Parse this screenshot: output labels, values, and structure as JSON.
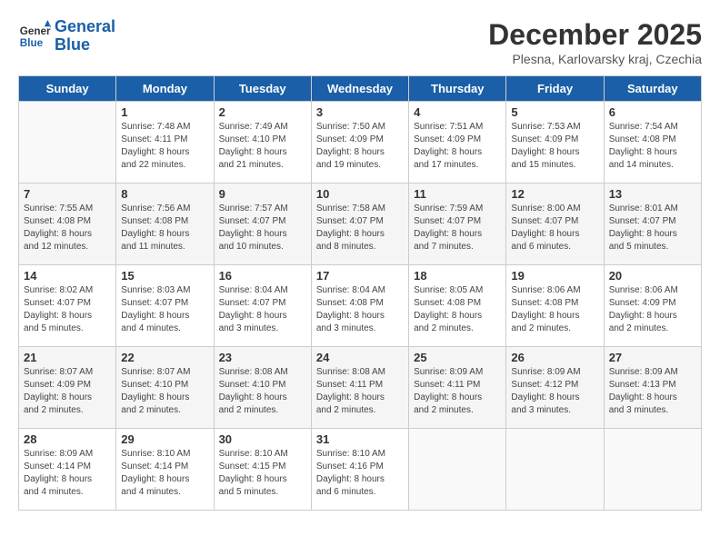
{
  "logo": {
    "line1": "General",
    "line2": "Blue"
  },
  "title": "December 2025",
  "subtitle": "Plesna, Karlovarsky kraj, Czechia",
  "weekdays": [
    "Sunday",
    "Monday",
    "Tuesday",
    "Wednesday",
    "Thursday",
    "Friday",
    "Saturday"
  ],
  "weeks": [
    [
      {
        "day": "",
        "info": ""
      },
      {
        "day": "1",
        "info": "Sunrise: 7:48 AM\nSunset: 4:11 PM\nDaylight: 8 hours\nand 22 minutes."
      },
      {
        "day": "2",
        "info": "Sunrise: 7:49 AM\nSunset: 4:10 PM\nDaylight: 8 hours\nand 21 minutes."
      },
      {
        "day": "3",
        "info": "Sunrise: 7:50 AM\nSunset: 4:09 PM\nDaylight: 8 hours\nand 19 minutes."
      },
      {
        "day": "4",
        "info": "Sunrise: 7:51 AM\nSunset: 4:09 PM\nDaylight: 8 hours\nand 17 minutes."
      },
      {
        "day": "5",
        "info": "Sunrise: 7:53 AM\nSunset: 4:09 PM\nDaylight: 8 hours\nand 15 minutes."
      },
      {
        "day": "6",
        "info": "Sunrise: 7:54 AM\nSunset: 4:08 PM\nDaylight: 8 hours\nand 14 minutes."
      }
    ],
    [
      {
        "day": "7",
        "info": "Sunrise: 7:55 AM\nSunset: 4:08 PM\nDaylight: 8 hours\nand 12 minutes."
      },
      {
        "day": "8",
        "info": "Sunrise: 7:56 AM\nSunset: 4:08 PM\nDaylight: 8 hours\nand 11 minutes."
      },
      {
        "day": "9",
        "info": "Sunrise: 7:57 AM\nSunset: 4:07 PM\nDaylight: 8 hours\nand 10 minutes."
      },
      {
        "day": "10",
        "info": "Sunrise: 7:58 AM\nSunset: 4:07 PM\nDaylight: 8 hours\nand 8 minutes."
      },
      {
        "day": "11",
        "info": "Sunrise: 7:59 AM\nSunset: 4:07 PM\nDaylight: 8 hours\nand 7 minutes."
      },
      {
        "day": "12",
        "info": "Sunrise: 8:00 AM\nSunset: 4:07 PM\nDaylight: 8 hours\nand 6 minutes."
      },
      {
        "day": "13",
        "info": "Sunrise: 8:01 AM\nSunset: 4:07 PM\nDaylight: 8 hours\nand 5 minutes."
      }
    ],
    [
      {
        "day": "14",
        "info": "Sunrise: 8:02 AM\nSunset: 4:07 PM\nDaylight: 8 hours\nand 5 minutes."
      },
      {
        "day": "15",
        "info": "Sunrise: 8:03 AM\nSunset: 4:07 PM\nDaylight: 8 hours\nand 4 minutes."
      },
      {
        "day": "16",
        "info": "Sunrise: 8:04 AM\nSunset: 4:07 PM\nDaylight: 8 hours\nand 3 minutes."
      },
      {
        "day": "17",
        "info": "Sunrise: 8:04 AM\nSunset: 4:08 PM\nDaylight: 8 hours\nand 3 minutes."
      },
      {
        "day": "18",
        "info": "Sunrise: 8:05 AM\nSunset: 4:08 PM\nDaylight: 8 hours\nand 2 minutes."
      },
      {
        "day": "19",
        "info": "Sunrise: 8:06 AM\nSunset: 4:08 PM\nDaylight: 8 hours\nand 2 minutes."
      },
      {
        "day": "20",
        "info": "Sunrise: 8:06 AM\nSunset: 4:09 PM\nDaylight: 8 hours\nand 2 minutes."
      }
    ],
    [
      {
        "day": "21",
        "info": "Sunrise: 8:07 AM\nSunset: 4:09 PM\nDaylight: 8 hours\nand 2 minutes."
      },
      {
        "day": "22",
        "info": "Sunrise: 8:07 AM\nSunset: 4:10 PM\nDaylight: 8 hours\nand 2 minutes."
      },
      {
        "day": "23",
        "info": "Sunrise: 8:08 AM\nSunset: 4:10 PM\nDaylight: 8 hours\nand 2 minutes."
      },
      {
        "day": "24",
        "info": "Sunrise: 8:08 AM\nSunset: 4:11 PM\nDaylight: 8 hours\nand 2 minutes."
      },
      {
        "day": "25",
        "info": "Sunrise: 8:09 AM\nSunset: 4:11 PM\nDaylight: 8 hours\nand 2 minutes."
      },
      {
        "day": "26",
        "info": "Sunrise: 8:09 AM\nSunset: 4:12 PM\nDaylight: 8 hours\nand 3 minutes."
      },
      {
        "day": "27",
        "info": "Sunrise: 8:09 AM\nSunset: 4:13 PM\nDaylight: 8 hours\nand 3 minutes."
      }
    ],
    [
      {
        "day": "28",
        "info": "Sunrise: 8:09 AM\nSunset: 4:14 PM\nDaylight: 8 hours\nand 4 minutes."
      },
      {
        "day": "29",
        "info": "Sunrise: 8:10 AM\nSunset: 4:14 PM\nDaylight: 8 hours\nand 4 minutes."
      },
      {
        "day": "30",
        "info": "Sunrise: 8:10 AM\nSunset: 4:15 PM\nDaylight: 8 hours\nand 5 minutes."
      },
      {
        "day": "31",
        "info": "Sunrise: 8:10 AM\nSunset: 4:16 PM\nDaylight: 8 hours\nand 6 minutes."
      },
      {
        "day": "",
        "info": ""
      },
      {
        "day": "",
        "info": ""
      },
      {
        "day": "",
        "info": ""
      }
    ]
  ]
}
